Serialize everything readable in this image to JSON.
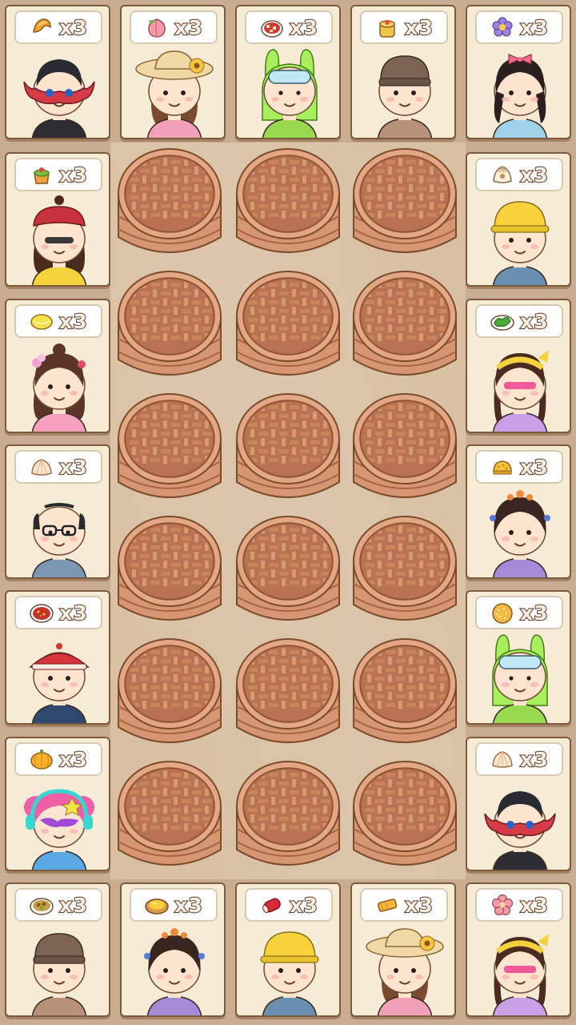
{
  "game": {
    "customers": [
      {
        "id": "c1",
        "dish": "dumpling-gold",
        "dish_icon": "gold-croissant-icon",
        "qty": "x3",
        "avatar": "masked-man-avatar",
        "hair": "#2a2a32",
        "skin": "#fde4cf",
        "shirt": "#2d2d33",
        "hat": "mask",
        "accent": "#d63b46"
      },
      {
        "id": "c2",
        "dish": "peach-bun",
        "dish_icon": "peach-bun-icon",
        "qty": "x3",
        "avatar": "sunhat-girl-avatar",
        "hair": "#7a4b30",
        "skin": "#fde4cf",
        "shirt": "#f2a0b8",
        "hat": "sunhat",
        "accent": "#f5c542"
      },
      {
        "id": "c3",
        "dish": "mapo-tofu",
        "dish_icon": "mapo-tofu-icon",
        "qty": "x3",
        "avatar": "bunny-hood-boy-avatar",
        "hair": "#3a2a22",
        "skin": "#fde4cf",
        "shirt": "#98d94d",
        "hat": "bunny",
        "accent": "#a7ef5c"
      },
      {
        "id": "c4",
        "dish": "shumai",
        "dish_icon": "shumai-icon",
        "qty": "x3",
        "avatar": "beanie-boy-avatar",
        "hair": "#3a2a22",
        "skin": "#fde4cf",
        "shirt": "#b8917a",
        "hat": "beanie",
        "accent": "#7c6455"
      },
      {
        "id": "c5",
        "dish": "flower-cake",
        "dish_icon": "purple-flower-cake-icon",
        "qty": "x3",
        "avatar": "bow-girl-avatar",
        "hair": "#2a1f1c",
        "skin": "#fde4cf",
        "shirt": "#9fd3ea",
        "hat": "bow",
        "accent": "#ef6f8a"
      },
      {
        "id": "c6",
        "dish": "green-pudding",
        "dish_icon": "osmanthus-pudding-icon",
        "qty": "x3",
        "avatar": "bandana-girl-avatar",
        "hair": "#4a2b1f",
        "skin": "#fde4cf",
        "shirt": "#f4d23b",
        "hat": "bandana",
        "accent": "#c8323c"
      },
      {
        "id": "c7",
        "dish": "dumpling",
        "dish_icon": "soup-dumpling-icon",
        "qty": "x3",
        "avatar": "hardhat-boy-avatar",
        "hair": "#3a2a22",
        "skin": "#fde4cf",
        "shirt": "#6a8fb0",
        "hat": "hardhat",
        "accent": "#f7d23b"
      },
      {
        "id": "c8",
        "dish": "lemon-pastry",
        "dish_icon": "lemon-pastry-icon",
        "qty": "x3",
        "avatar": "flower-hair-girl-avatar",
        "hair": "#5a3528",
        "skin": "#fde4cf",
        "shirt": "#f5a0bf",
        "hat": "flowers",
        "accent": "#e04a60"
      },
      {
        "id": "c9",
        "dish": "green-veg",
        "dish_icon": "green-vegetable-icon",
        "qty": "x3",
        "avatar": "headband-girl-avatar",
        "hair": "#4a2b22",
        "skin": "#fde4cf",
        "shirt": "#c9a0e8",
        "hat": "headband",
        "accent": "#f4d23b"
      },
      {
        "id": "c10",
        "dish": "bao",
        "dish_icon": "steamed-bao-icon",
        "qty": "x3",
        "avatar": "glasses-man-avatar",
        "hair": "#2a2a2a",
        "skin": "#fde4cf",
        "shirt": "#7a97b2",
        "hat": "bald",
        "accent": "#2a2a2a"
      },
      {
        "id": "c11",
        "dish": "sponge-cake",
        "dish_icon": "sponge-cake-icon",
        "qty": "x3",
        "avatar": "hanfu-girl-avatar",
        "hair": "#3a2620",
        "skin": "#fde4cf",
        "shirt": "#a58ad8",
        "hat": "hairpins",
        "accent": "#f08a3a"
      },
      {
        "id": "c12",
        "dish": "spicy-soup",
        "dish_icon": "spicy-soup-icon",
        "qty": "x3",
        "avatar": "qing-hat-boy-avatar",
        "hair": "#2a2a2a",
        "skin": "#fde4cf",
        "shirt": "#2f4a6e",
        "hat": "qing",
        "accent": "#d7343c"
      },
      {
        "id": "c13",
        "dish": "sesame-ball",
        "dish_icon": "sesame-ball-icon",
        "qty": "x3",
        "avatar": "bunny-hood-boy-avatar",
        "hair": "#3a2a22",
        "skin": "#fde4cf",
        "shirt": "#98d94d",
        "hat": "bunny",
        "accent": "#a7ef5c"
      },
      {
        "id": "c14",
        "dish": "pumpkin-cake",
        "dish_icon": "pumpkin-cake-icon",
        "qty": "x3",
        "avatar": "pink-hair-girl-avatar",
        "hair": "#ef5fa8",
        "skin": "#fde4cf",
        "shirt": "#5aa9e6",
        "hat": "headphones",
        "accent": "#38d6d0"
      },
      {
        "id": "c15",
        "dish": "bao-2",
        "dish_icon": "steamed-bao-icon",
        "qty": "x3",
        "avatar": "masked-man-avatar",
        "hair": "#2a2a32",
        "skin": "#fde4cf",
        "shirt": "#2d2d33",
        "hat": "mask",
        "accent": "#d63b46"
      },
      {
        "id": "c16",
        "dish": "curry-dish",
        "dish_icon": "curry-plate-icon",
        "qty": "x3",
        "avatar": "beanie-boy-avatar",
        "hair": "#3a2a22",
        "skin": "#fde4cf",
        "shirt": "#b8917a",
        "hat": "beanie",
        "accent": "#7c6455"
      },
      {
        "id": "c17",
        "dish": "egg-tart",
        "dish_icon": "egg-tart-icon",
        "qty": "x3",
        "avatar": "hanfu-girl-avatar",
        "hair": "#3a2620",
        "skin": "#fde4cf",
        "shirt": "#a58ad8",
        "hat": "hairpins",
        "accent": "#f08a3a"
      },
      {
        "id": "c18",
        "dish": "sausage-roll",
        "dish_icon": "sausage-roll-icon",
        "qty": "x3",
        "avatar": "hardhat-boy-avatar",
        "hair": "#3a2a22",
        "skin": "#fde4cf",
        "shirt": "#6a8fb0",
        "hat": "hardhat",
        "accent": "#f7d23b"
      },
      {
        "id": "c19",
        "dish": "spring-roll",
        "dish_icon": "spring-roll-icon",
        "qty": "x3",
        "avatar": "sunhat-girl-avatar",
        "hair": "#7a4b30",
        "skin": "#fde4cf",
        "shirt": "#f2a0b8",
        "hat": "sunhat",
        "accent": "#f5c542"
      },
      {
        "id": "c20",
        "dish": "pink-flower-cake",
        "dish_icon": "pink-flower-cake-icon",
        "qty": "x3",
        "avatar": "headband-girl-avatar",
        "hair": "#4a2b22",
        "skin": "#fde4cf",
        "shirt": "#c9a0e8",
        "hat": "headband",
        "accent": "#f4d23b"
      }
    ],
    "steamer_rows": 6,
    "steamer_cols": 3,
    "colors": {
      "board": "#d9c0a3",
      "card_bg": "#f6ecd6",
      "card_border": "#7d5a3c",
      "steamer": "#d59671",
      "steamer_dark": "#a8643f"
    }
  }
}
